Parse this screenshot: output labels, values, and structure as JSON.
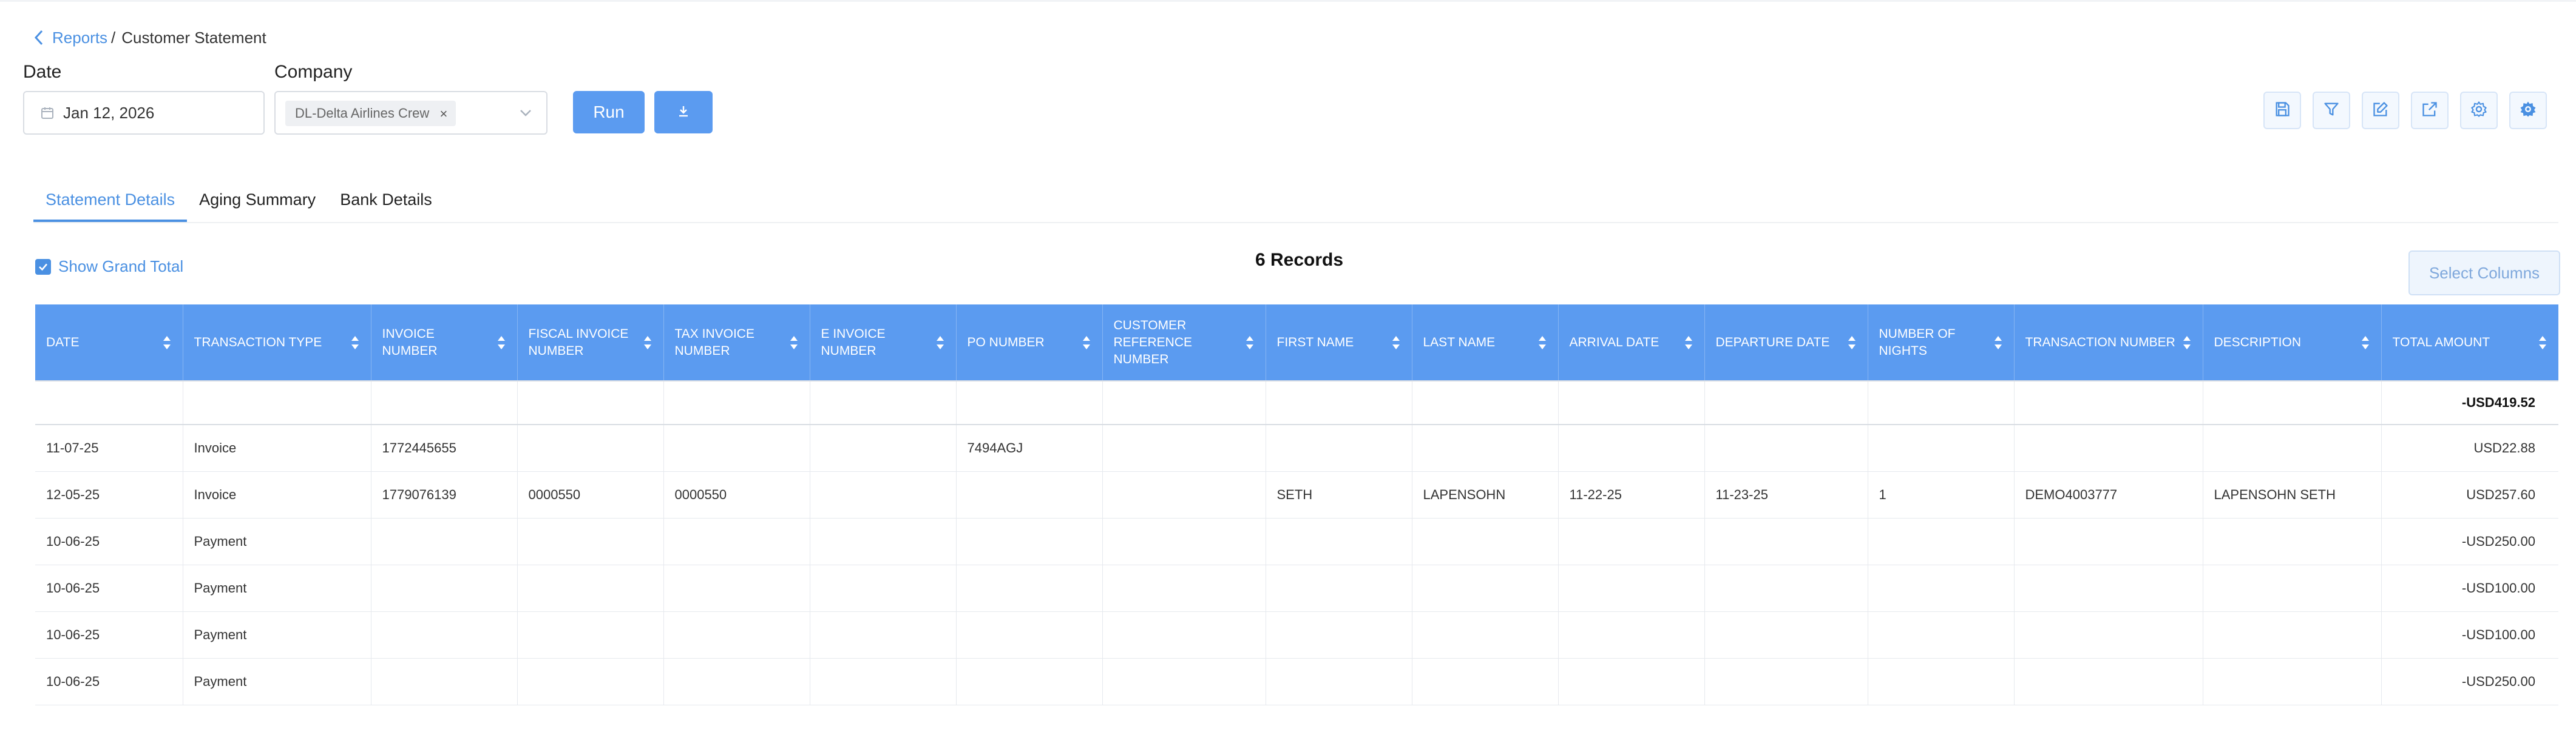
{
  "breadcrumb": {
    "parent": "Reports",
    "separator": "/",
    "current": "Customer Statement"
  },
  "filters": {
    "date_label": "Date",
    "date_value": "Jan 12, 2026",
    "company_label": "Company",
    "company_tag": "DL-Delta Airlines Crew",
    "company_tag_remove": "×"
  },
  "actions": {
    "run_label": "Run"
  },
  "toolbar_icons": [
    "save-icon",
    "filter-icon",
    "edit-icon",
    "external-link-icon",
    "settings-icon",
    "advanced-settings-icon"
  ],
  "tabs": [
    {
      "label": "Statement Details",
      "active": true
    },
    {
      "label": "Aging Summary",
      "active": false
    },
    {
      "label": "Bank Details",
      "active": false
    }
  ],
  "show_grand_total": {
    "label": "Show Grand Total",
    "checked": true
  },
  "records_label": "6 Records",
  "select_columns_label": "Select Columns",
  "accent_color": "#5b9bf0",
  "table": {
    "columns": [
      "DATE",
      "TRANSACTION TYPE",
      "INVOICE NUMBER",
      "FISCAL INVOICE NUMBER",
      "TAX INVOICE NUMBER",
      "E INVOICE NUMBER",
      "PO NUMBER",
      "CUSTOMER REFERENCE NUMBER",
      "FIRST NAME",
      "LAST NAME",
      "ARRIVAL DATE",
      "DEPARTURE DATE",
      "NUMBER OF NIGHTS",
      "TRANSACTION NUMBER",
      "DESCRIPTION",
      "TOTAL AMOUNT"
    ],
    "grand_total": "-USD419.52",
    "rows": [
      [
        "11-07-25",
        "Invoice",
        "1772445655",
        "",
        "",
        "",
        "7494AGJ",
        "",
        "",
        "",
        "",
        "",
        "",
        "",
        "",
        "USD22.88"
      ],
      [
        "12-05-25",
        "Invoice",
        "1779076139",
        "0000550",
        "0000550",
        "",
        "",
        "",
        "SETH",
        "LAPENSOHN",
        "11-22-25",
        "11-23-25",
        "1",
        "DEMO4003777",
        "LAPENSOHN SETH",
        "USD257.60"
      ],
      [
        "10-06-25",
        "Payment",
        "",
        "",
        "",
        "",
        "",
        "",
        "",
        "",
        "",
        "",
        "",
        "",
        "",
        "-USD250.00"
      ],
      [
        "10-06-25",
        "Payment",
        "",
        "",
        "",
        "",
        "",
        "",
        "",
        "",
        "",
        "",
        "",
        "",
        "",
        "-USD100.00"
      ],
      [
        "10-06-25",
        "Payment",
        "",
        "",
        "",
        "",
        "",
        "",
        "",
        "",
        "",
        "",
        "",
        "",
        "",
        "-USD100.00"
      ],
      [
        "10-06-25",
        "Payment",
        "",
        "",
        "",
        "",
        "",
        "",
        "",
        "",
        "",
        "",
        "",
        "",
        "",
        "-USD250.00"
      ]
    ]
  }
}
